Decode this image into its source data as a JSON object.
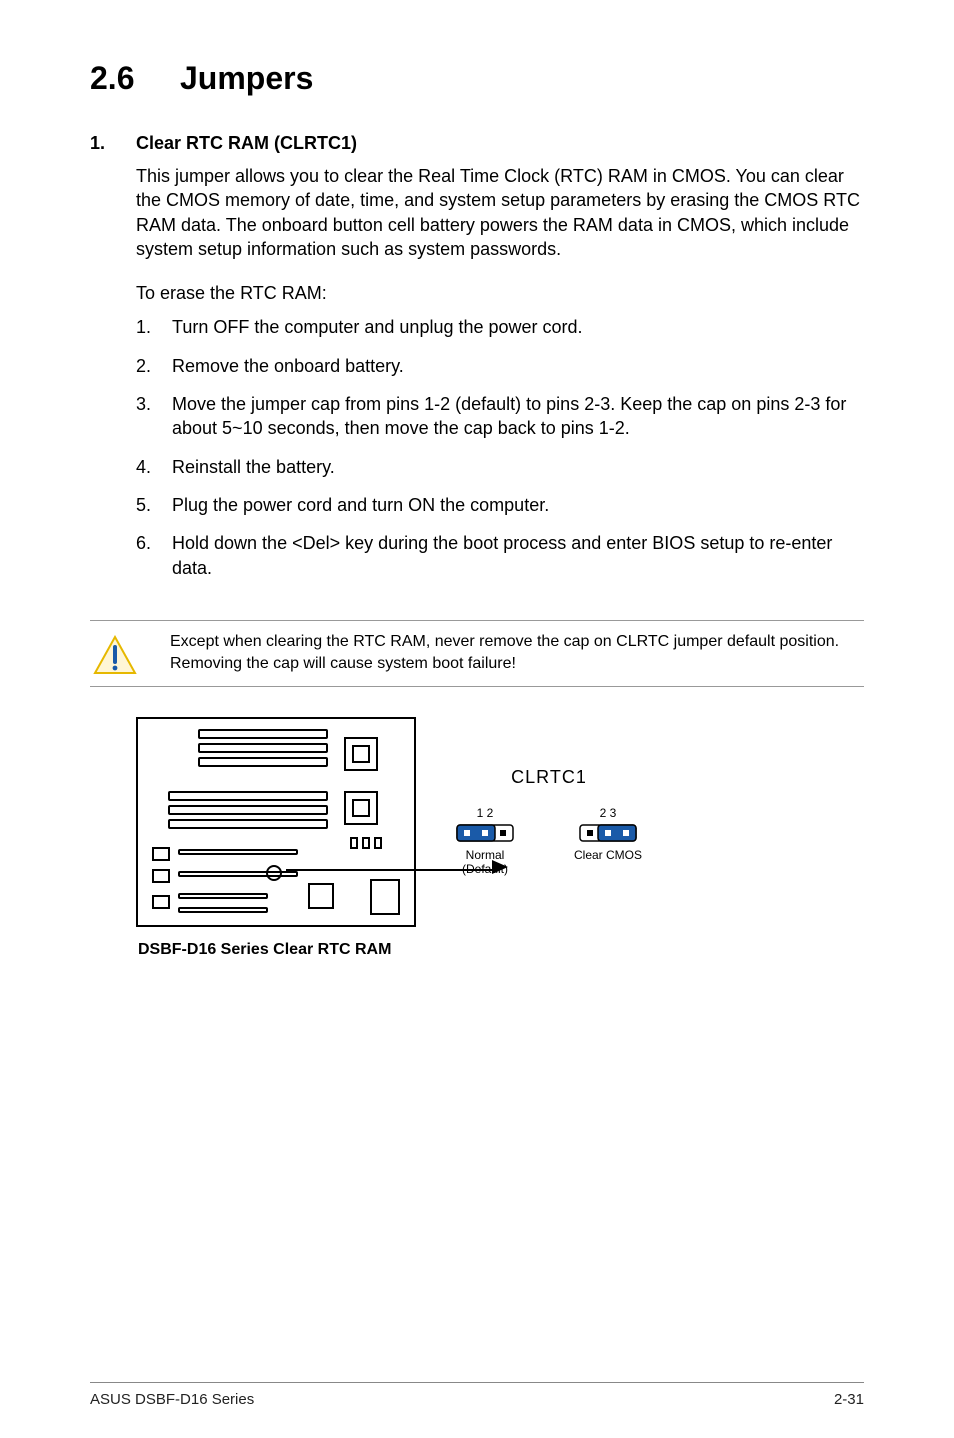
{
  "heading": {
    "number": "2.6",
    "title": "Jumpers"
  },
  "item1": {
    "num": "1.",
    "title": "Clear RTC RAM (CLRTC1)",
    "para1": "This jumper allows you to clear the  Real Time Clock (RTC) RAM in CMOS. You can clear the CMOS memory of date, time, and system setup parameters by erasing the CMOS RTC RAM data. The onboard button cell battery powers the RAM data in CMOS, which include system setup information such as system passwords.",
    "para2": "To erase the RTC RAM:",
    "steps": [
      {
        "n": "1.",
        "t": "Turn OFF the computer and unplug the power cord."
      },
      {
        "n": "2.",
        "t": "Remove the onboard battery."
      },
      {
        "n": "3.",
        "t": "Move the jumper cap from pins 1-2 (default) to pins 2-3. Keep the cap on pins 2-3 for about 5~10 seconds, then move the cap back to pins 1-2."
      },
      {
        "n": "4.",
        "t": "Reinstall the battery."
      },
      {
        "n": "5.",
        "t": "Plug the power cord and turn ON the computer."
      },
      {
        "n": "6.",
        "t": "Hold down the <Del> key during the boot process and enter BIOS setup to re-enter data."
      }
    ]
  },
  "note": "Except when clearing the RTC RAM, never remove the cap on CLRTC jumper default position. Removing the cap will cause system boot failure!",
  "diagram": {
    "jumperLabel": "CLRTC1",
    "left": {
      "pins": "1  2",
      "caption1": "Normal",
      "caption2": "(Default)"
    },
    "right": {
      "pins": "2  3",
      "caption1": "Clear CMOS"
    },
    "caption": "DSBF-D16 Series Clear RTC RAM"
  },
  "footer": {
    "left": "ASUS DSBF-D16 Series",
    "right": "2-31"
  }
}
